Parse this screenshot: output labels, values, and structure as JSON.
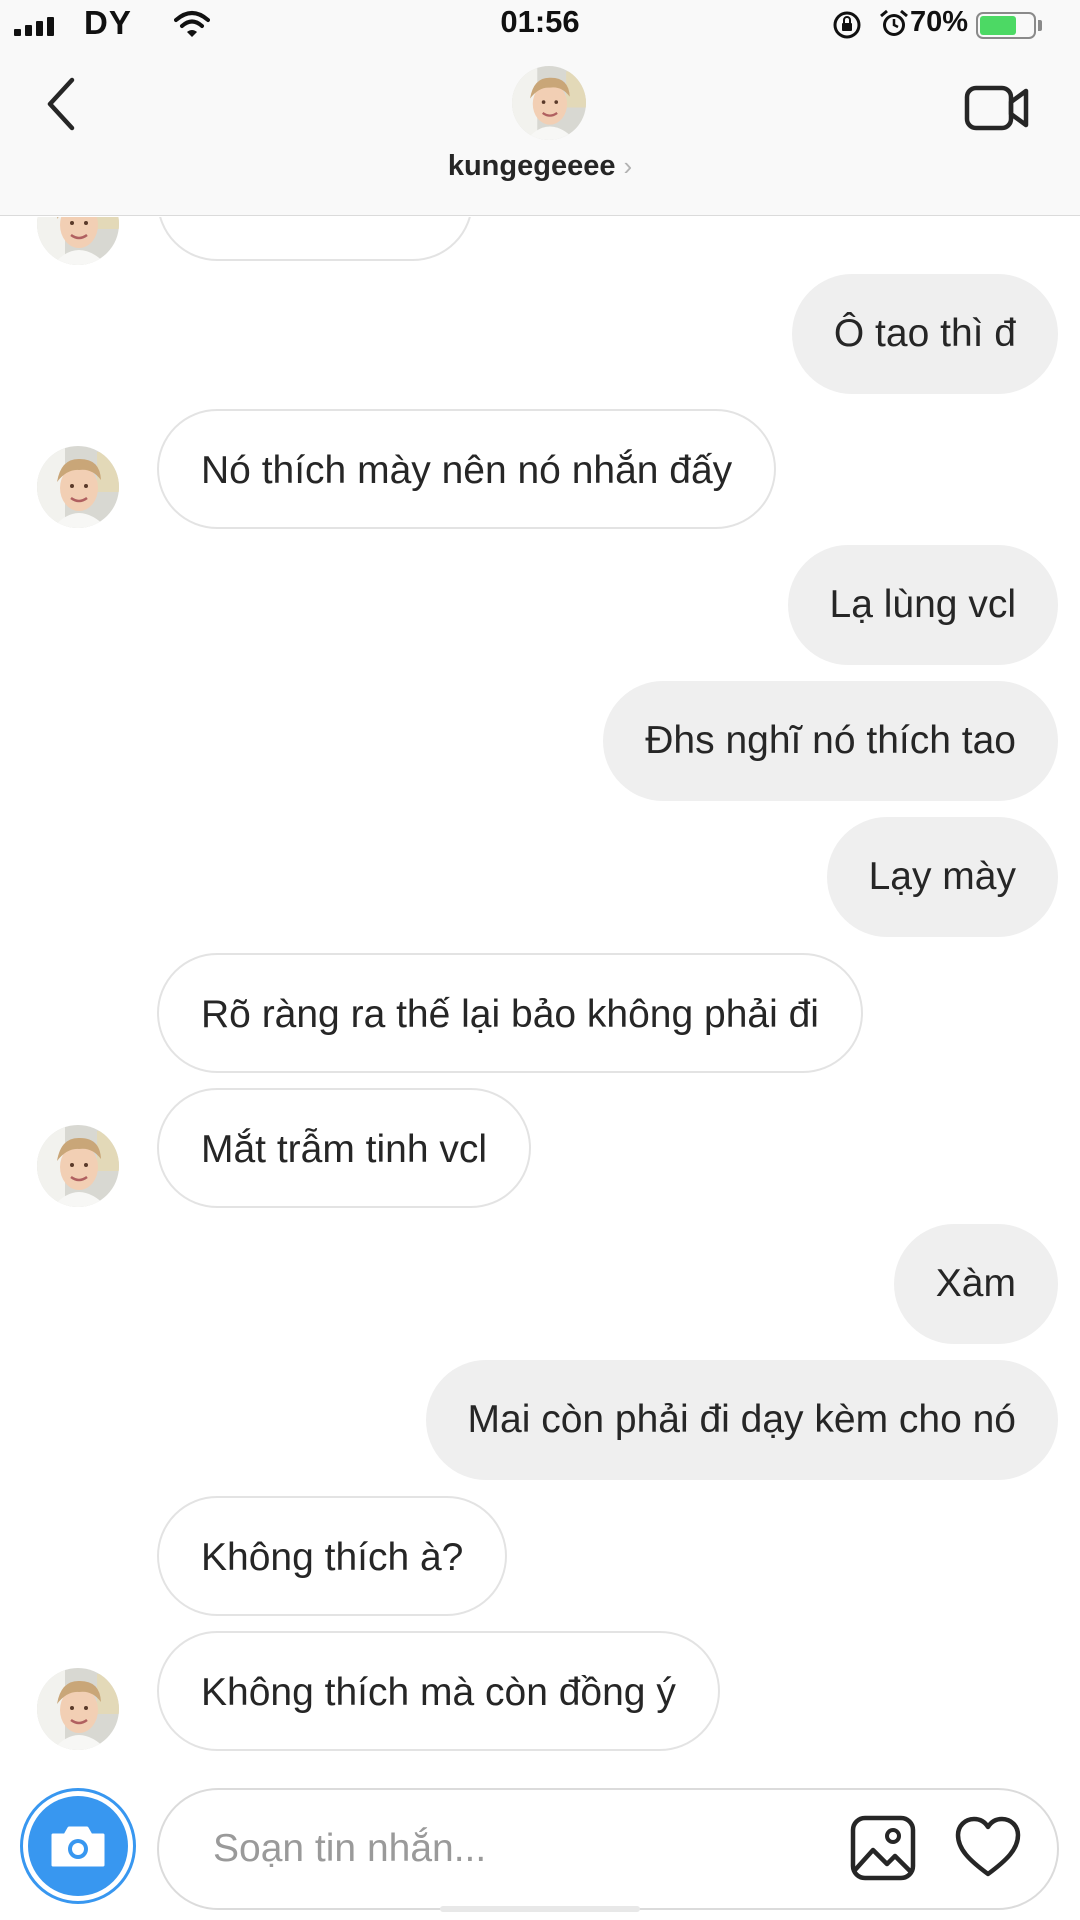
{
  "status_bar": {
    "carrier": "DY",
    "time": "01:56",
    "battery": "70%",
    "battery_level": 0.7
  },
  "header": {
    "username": "kungegeeee",
    "chevron": "›"
  },
  "messages": [
    {
      "direction": "incoming",
      "text": ""
    },
    {
      "direction": "outgoing",
      "text": "Ô tao thì đ"
    },
    {
      "direction": "incoming",
      "text": "Nó thích mày nên nó nhắn đấy"
    },
    {
      "direction": "outgoing",
      "text": "Lạ lùng vcl"
    },
    {
      "direction": "outgoing",
      "text": "Đhs nghĩ nó thích tao"
    },
    {
      "direction": "outgoing",
      "text": "Lạy mày"
    },
    {
      "direction": "incoming",
      "text": "Rõ ràng ra thế lại bảo không phải đi"
    },
    {
      "direction": "incoming",
      "text": "Mắt trẫm tinh vcl"
    },
    {
      "direction": "outgoing",
      "text": "Xàm"
    },
    {
      "direction": "outgoing",
      "text": "Mai còn phải đi dạy kèm cho nó"
    },
    {
      "direction": "incoming",
      "text": "Không thích à?"
    },
    {
      "direction": "incoming",
      "text": "Không thích mà còn đồng ý"
    }
  ],
  "composer": {
    "placeholder": "Soạn tin nhắn..."
  },
  "icons": {
    "back": "chevron-left-icon",
    "video_call": "video-camera-icon",
    "camera": "camera-icon",
    "gallery": "image-icon",
    "like": "heart-icon"
  },
  "colors": {
    "accent": "#3897f0",
    "outgoing_bubble": "#efefef",
    "incoming_border": "#e3e3e3",
    "battery_fill": "#4cd964"
  }
}
